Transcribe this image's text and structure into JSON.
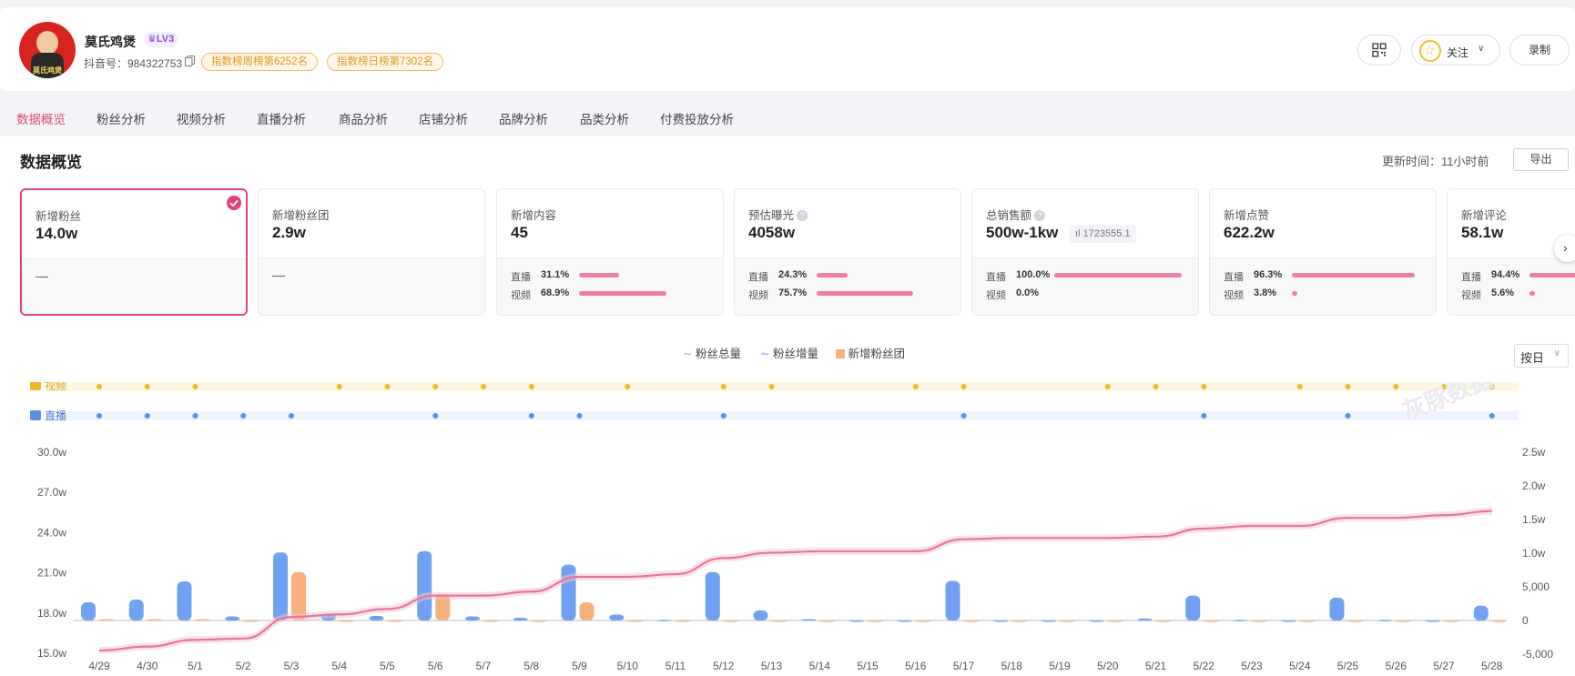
{
  "profile": {
    "name": "莫氏鸡煲",
    "level": "LV3",
    "avatar_text": "莫氏鸡煲",
    "douyin_id_label": "抖音号：",
    "douyin_id": "984322753",
    "weekly_rank": "指数榜周榜第6252名",
    "daily_rank": "指数榜日榜第7302名",
    "follow_label": "关注",
    "record_label": "录制"
  },
  "tabs": [
    "数据概览",
    "粉丝分析",
    "视频分析",
    "直播分析",
    "商品分析",
    "店铺分析",
    "品牌分析",
    "品类分析",
    "付费投放分析"
  ],
  "overview": {
    "title": "数据概览",
    "update_time": "更新时间：11小时前",
    "export_label": "导出"
  },
  "cards": [
    {
      "label": "新增粉丝",
      "value": "14.0w",
      "dash": "—",
      "selected": true
    },
    {
      "label": "新增粉丝团",
      "value": "2.9w",
      "dash": "—"
    },
    {
      "label": "新增内容",
      "value": "45",
      "live_label": "直播",
      "live_pct": "31.1%",
      "live_frac": 0.311,
      "video_label": "视频",
      "video_pct": "68.9%",
      "video_frac": 0.689
    },
    {
      "label": "预估曝光",
      "value": "4058w",
      "live_label": "直播",
      "live_pct": "24.3%",
      "live_frac": 0.243,
      "video_label": "视频",
      "video_pct": "75.7%",
      "video_frac": 0.757
    },
    {
      "label": "总销售额",
      "value": "500w-1kw",
      "chip": "1723555.1",
      "live_label": "直播",
      "live_pct": "100.0%",
      "live_frac": 1.0,
      "video_label": "视频",
      "video_pct": "0.0%",
      "video_frac": 0.0
    },
    {
      "label": "新增点赞",
      "value": "622.2w",
      "live_label": "直播",
      "live_pct": "96.3%",
      "live_frac": 0.963,
      "video_label": "视频",
      "video_pct": "3.8%",
      "video_frac": 0.038
    },
    {
      "label": "新增评论",
      "value": "58.1w",
      "live_label": "直播",
      "live_pct": "94.4%",
      "live_frac": 0.944,
      "video_label": "视频",
      "video_pct": "5.6%",
      "video_frac": 0.056
    }
  ],
  "legend": {
    "total": "粉丝总量",
    "increase": "粉丝增量",
    "fan_club": "新增粉丝团"
  },
  "day_select": "按日",
  "rows": {
    "video": "视频",
    "live": "直播"
  },
  "watermark": "灰豚数据",
  "colors": {
    "accent": "#e0437a",
    "blue_bar": "#6fa2f2",
    "orange_bar": "#f7b07c",
    "line": "#e8759a",
    "video_dot": "#f1b722",
    "live_dot": "#5b8fe0"
  },
  "chart_data": {
    "type": "bar",
    "categories": [
      "4/29",
      "4/30",
      "5/1",
      "5/2",
      "5/3",
      "5/4",
      "5/5",
      "5/6",
      "5/7",
      "5/8",
      "5/9",
      "5/10",
      "5/11",
      "5/12",
      "5/13",
      "5/14",
      "5/15",
      "5/16",
      "5/17",
      "5/18",
      "5/19",
      "5/20",
      "5/21",
      "5/22",
      "5/23",
      "5/24",
      "5/25",
      "5/26",
      "5/27",
      "5/28"
    ],
    "y_left_ticks": [
      "15.0w",
      "18.0w",
      "21.0w",
      "24.0w",
      "27.0w",
      "30.0w"
    ],
    "y_left_range": [
      15.0,
      30.0
    ],
    "y_right_ticks": [
      "-5,000",
      "0",
      "5,000",
      "1.0w",
      "1.5w",
      "2.0w",
      "2.5w"
    ],
    "y_right_range": [
      -5000,
      25000
    ],
    "series": [
      {
        "name": "粉丝总量",
        "type": "line",
        "axis": "left",
        "values": [
          15.2,
          15.5,
          16.0,
          16.1,
          17.7,
          17.9,
          18.3,
          19.3,
          19.3,
          19.6,
          20.7,
          20.7,
          20.9,
          22.1,
          22.5,
          22.6,
          22.6,
          22.6,
          23.5,
          23.6,
          23.6,
          23.6,
          23.7,
          24.3,
          24.5,
          24.5,
          25.1,
          25.1,
          25.3,
          25.6
        ]
      },
      {
        "name": "粉丝增量",
        "type": "bar",
        "axis": "right",
        "values": [
          2700,
          3100,
          5800,
          600,
          10100,
          1000,
          700,
          10300,
          600,
          400,
          8300,
          900,
          100,
          7200,
          1500,
          200,
          0,
          0,
          5900,
          -200,
          -200,
          -200,
          300,
          3700,
          100,
          0,
          3400,
          100,
          0,
          2200
        ]
      },
      {
        "name": "新增粉丝团",
        "type": "bar",
        "axis": "right",
        "values": [
          200,
          200,
          200,
          0,
          7200,
          0,
          0,
          3900,
          0,
          0,
          2700,
          0,
          0,
          0,
          0,
          0,
          0,
          0,
          0,
          0,
          0,
          0,
          0,
          0,
          0,
          0,
          0,
          0,
          0,
          0
        ]
      }
    ],
    "video_days": [
      "4/29",
      "4/30",
      "5/1",
      "5/4",
      "5/5",
      "5/6",
      "5/7",
      "5/8",
      "5/10",
      "5/12",
      "5/13",
      "5/16",
      "5/17",
      "5/20",
      "5/21",
      "5/22",
      "5/24",
      "5/25",
      "5/26",
      "5/27",
      "5/28"
    ],
    "live_days": [
      "4/29",
      "4/30",
      "5/1",
      "5/2",
      "5/3",
      "5/6",
      "5/8",
      "5/9",
      "5/12",
      "5/17",
      "5/22",
      "5/25",
      "5/28"
    ]
  }
}
